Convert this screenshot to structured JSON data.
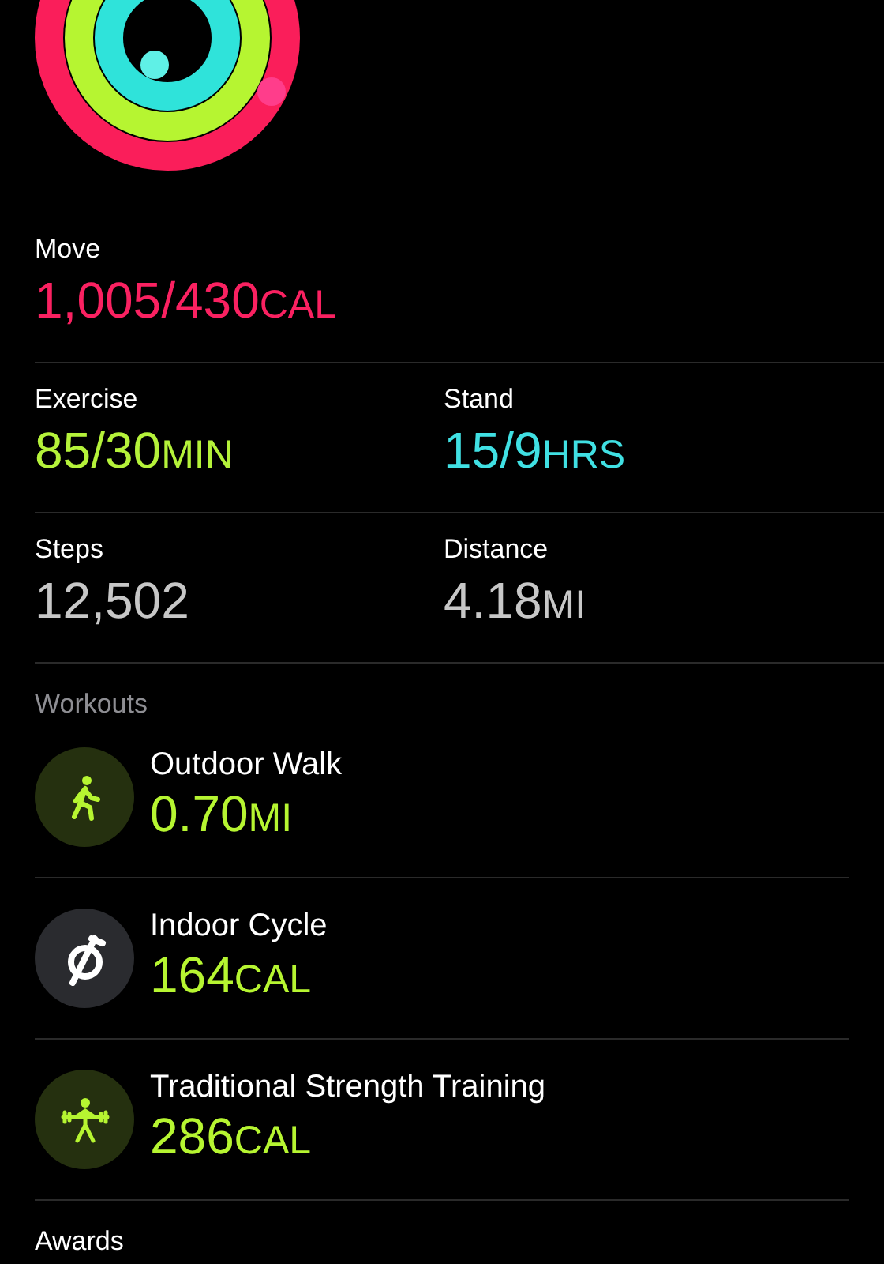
{
  "summary": [
    {
      "label": "Move",
      "value": "1,005/430",
      "unit": "CAL",
      "color": "#fa2161"
    },
    {
      "label": "Exercise",
      "value": "85/30",
      "unit": "MIN",
      "color": "#b5f23a"
    },
    {
      "label": "Stand",
      "value": "15/9",
      "unit": "HRS",
      "color": "#40e0e3"
    },
    {
      "label": "Steps",
      "value": "12,502",
      "color": "#c7c7c7"
    },
    {
      "label": "Distance",
      "value": "4.18",
      "unit": "MI",
      "color": "#c7c7c7"
    }
  ],
  "workouts": {
    "title": "Workouts",
    "items": [
      {
        "kind": "walk",
        "name": "Outdoor Walk",
        "value": "0.70",
        "unit": "MI"
      },
      {
        "kind": "cycle",
        "name": "Indoor Cycle",
        "value": "164",
        "unit": "CAL"
      },
      {
        "kind": "strength",
        "name": "Traditional Strength Training",
        "value": "286",
        "unit": "CAL"
      }
    ]
  },
  "awards": {
    "title": "Awards"
  }
}
